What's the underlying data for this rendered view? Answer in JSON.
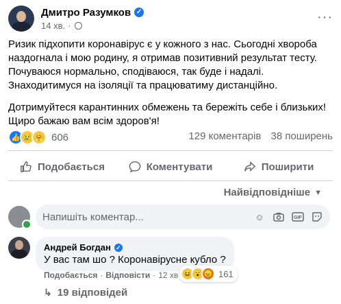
{
  "post": {
    "author": "Дмитро Разумков",
    "time": "14 хв.",
    "paragraphs": [
      "Ризик підхопити коронавірус є у кожного з нас. Сьогодні хвороба наздогнала і мою родину, я отримав позитивний результат тесту. Почуваюся нормально, сподіваюся, так буде і надалі. Знаходитимуся на ізоляції та працюватиму дистанційно.",
      "Дотримуйтеся карантинних обмежень та бережіть себе і близьких! Щиро бажаю вам всім здоров'я!"
    ],
    "reaction_count": "606",
    "comments_count": "129 коментарів",
    "shares_count": "38 поширень",
    "reaction_icons": [
      "like-icon",
      "sad-icon",
      "care-icon"
    ]
  },
  "actions": {
    "like": "Подобається",
    "comment": "Коментувати",
    "share": "Поширити"
  },
  "sort_label": "Найвідповідніше",
  "composer": {
    "placeholder": "Напишіть коментар..."
  },
  "comment": {
    "author": "Андрей Богдан",
    "text": "У вас там шо ? Коронавірусне кубло ?",
    "like_label": "Подобається",
    "reply_label": "Відповісти",
    "time": "12 хв",
    "reaction_count": "161",
    "reaction_icons": [
      "haha-icon",
      "wow-icon",
      "angry-icon"
    ]
  },
  "replies_label": "19 відповідей",
  "colors": {
    "brand_blue": "#1877f2",
    "secondary_text": "#65676b",
    "bubble_bg": "#f0f2f5"
  }
}
